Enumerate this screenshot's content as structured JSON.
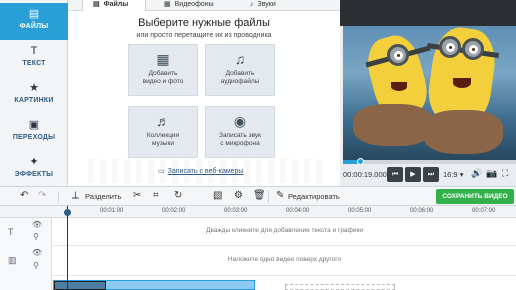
{
  "sidebar": {
    "items": [
      {
        "label": "ФАЙЛЫ",
        "icon": "▤"
      },
      {
        "label": "ТЕКСТ",
        "icon": "T"
      },
      {
        "label": "КАРТИНКИ",
        "icon": "★"
      },
      {
        "label": "ПЕРЕХОДЫ",
        "icon": "▣"
      },
      {
        "label": "ЭФФЕКТЫ",
        "icon": "✦"
      }
    ]
  },
  "tabs": [
    {
      "label": "Файлы",
      "icon": "▤"
    },
    {
      "label": "Видеофоны",
      "icon": "▦"
    },
    {
      "label": "Звуки",
      "icon": "♪"
    }
  ],
  "main": {
    "title": "Выберите нужные файлы",
    "subtitle": "или просто перетащите их из проводника",
    "cards": [
      {
        "label": "Добавить\nвидео и фото",
        "icon": "film-icon",
        "glyph": "▦"
      },
      {
        "label": "Добавить\nаудиофайлы",
        "icon": "audio-file-icon",
        "glyph": "♫"
      },
      {
        "label": "Коллекция\nмузыки",
        "icon": "music-notes-icon",
        "glyph": "♬"
      },
      {
        "label": "Записать звук\nс микрофона",
        "icon": "microphone-icon",
        "glyph": "◉"
      }
    ],
    "webcam_label": "Записать с веб-камеры"
  },
  "player": {
    "time": "00:00:19.000",
    "ratio": "16:9",
    "ratio_arrow": "▾",
    "progress": 0.1,
    "buttons": {
      "prev": "⏮",
      "play": "▶",
      "next": "⏭",
      "volume": "🔊",
      "snapshot": "📷",
      "fullscreen": "⛶"
    }
  },
  "toolbar": {
    "undo": "↶",
    "redo": "↷",
    "split_label": "Разделить",
    "split_icon": "⟂",
    "cut_icon": "✂",
    "crop_icon": "⌗",
    "rotate_icon": "↻",
    "image_icon": "▧",
    "delete_icon": "🗑",
    "edit_label": "Редактировать",
    "edit_icon": "✎",
    "save_label": "СОХРАНИТЬ ВИДЕО"
  },
  "timeline": {
    "ticks": [
      "00:01:00",
      "00:02:00",
      "00:03:00",
      "00:04:00",
      "00:05:00",
      "00:06:00",
      "00:07:00"
    ],
    "text_track_hint": "Дважды кликните для добавления текста и графики",
    "overlay_track_hint": "Наложите одно видео поверх другого",
    "text_track_icon": "T",
    "overlay_track_icon": "▥",
    "eye_icon": "👁",
    "link_icon": "⚲"
  },
  "colors": {
    "accent": "#2a9fd6",
    "save": "#32b04b"
  }
}
